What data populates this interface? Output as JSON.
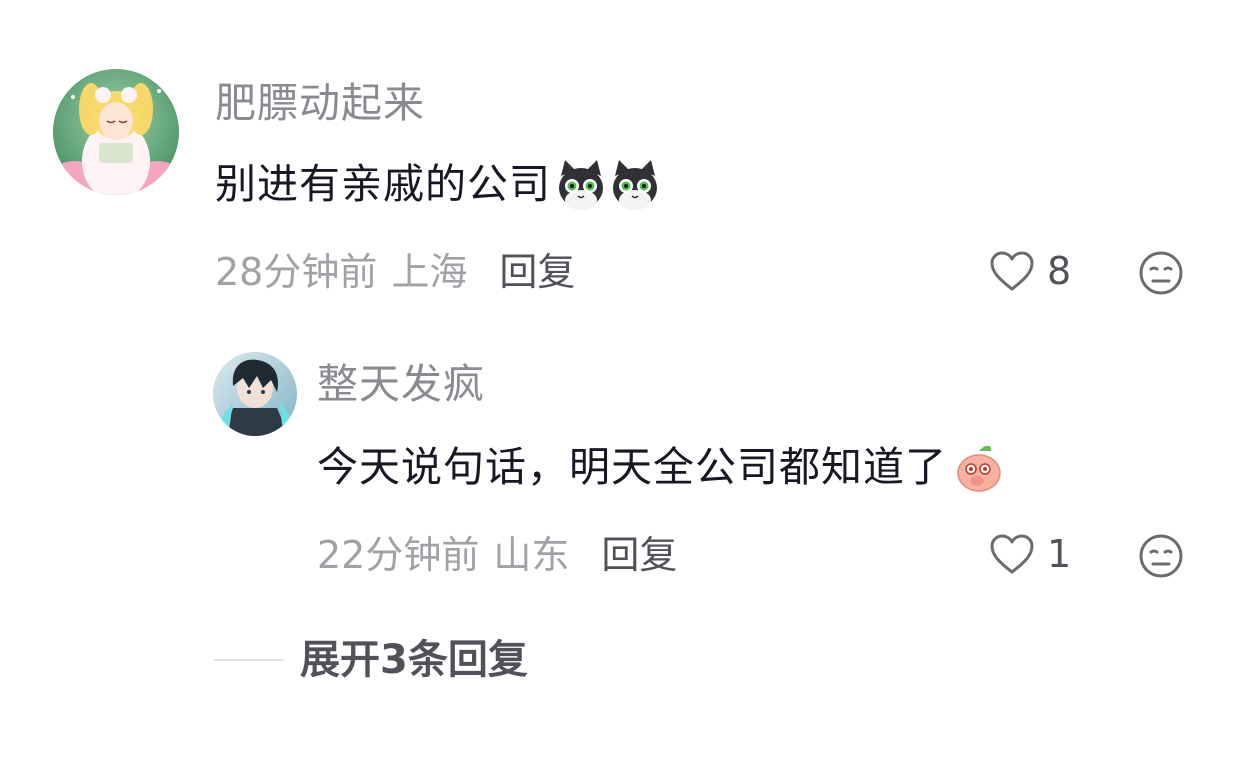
{
  "comments": [
    {
      "username": "肥膘动起来",
      "text": "别进有亲戚的公司",
      "emojis": [
        "cat-sticker-emoji",
        "cat-sticker-emoji"
      ],
      "time": "28分钟前",
      "location": "上海",
      "reply_label": "回复",
      "likes": "8",
      "avatar_icon": "sailor-moon-avatar"
    },
    {
      "username": "整天发疯",
      "text": "今天说句话，明天全公司都知道了",
      "emojis": [
        "peach-sticker-emoji"
      ],
      "time": "22分钟前",
      "location": "山东",
      "reply_label": "回复",
      "likes": "1",
      "avatar_icon": "anime-boy-avatar"
    }
  ],
  "expand_replies": {
    "label": "展开3条回复"
  },
  "colors": {
    "username": "#8a8b91",
    "text": "#161823",
    "meta": "#a1a2a7",
    "action": "#505159"
  }
}
